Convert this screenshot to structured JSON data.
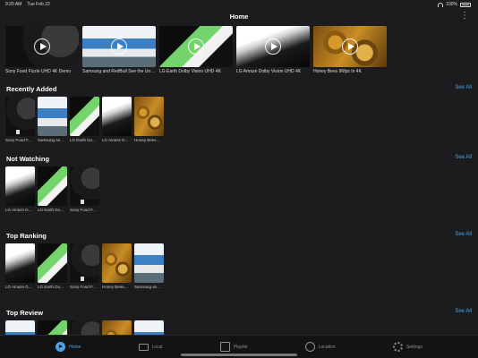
{
  "status": {
    "time": "9:20 AM",
    "date": "Tue Feb 22",
    "battery": "100%"
  },
  "header": {
    "title": "Home",
    "more": "⋮"
  },
  "featured": [
    {
      "label": "Sony Food Fizzle UHD 4K Demo",
      "thumb": "sony"
    },
    {
      "label": "Samsung and RedBull See the Unexpected",
      "thumb": "samsung"
    },
    {
      "label": "LG Earth Dolby Vision UHD 4K",
      "thumb": "lgearth"
    },
    {
      "label": "LG Amaze Dolby Vision UHD 4K",
      "thumb": "lgamaze"
    },
    {
      "label": "Honey Bees 96fps In 4K",
      "thumb": "bees"
    }
  ],
  "sections": [
    {
      "title": "Recently Added",
      "see_all": "See All",
      "items": [
        {
          "label": "Sony Food F...",
          "thumb": "sony",
          "doc": true
        },
        {
          "label": "Samsung an...",
          "thumb": "samsung",
          "doc": false
        },
        {
          "label": "LG Earth Do...",
          "thumb": "lgearth",
          "doc": false
        },
        {
          "label": "LG Amaze D...",
          "thumb": "lgamaze",
          "doc": false
        },
        {
          "label": "Honey Bees...",
          "thumb": "bees",
          "doc": false
        }
      ]
    },
    {
      "title": "Not Watching",
      "see_all": "See All",
      "items": [
        {
          "label": "LG Amaze D...",
          "thumb": "lgamaze",
          "doc": false
        },
        {
          "label": "LG Earth Do...",
          "thumb": "lgearth",
          "doc": false
        },
        {
          "label": "Sony Food F...",
          "thumb": "sony",
          "doc": true
        }
      ]
    },
    {
      "title": "Top Ranking",
      "see_all": "See All",
      "items": [
        {
          "label": "LG Amaze D...",
          "thumb": "lgamaze",
          "doc": false
        },
        {
          "label": "LG Earth Do...",
          "thumb": "lgearth",
          "doc": false
        },
        {
          "label": "Sony Food F...",
          "thumb": "sony",
          "doc": true
        },
        {
          "label": "Honey Bees...",
          "thumb": "bees",
          "doc": false
        },
        {
          "label": "Samsung an...",
          "thumb": "samsung",
          "doc": false
        }
      ]
    },
    {
      "title": "Top Review",
      "see_all": "See All",
      "items": [
        {
          "label": "",
          "thumb": "samsung",
          "doc": false
        },
        {
          "label": "",
          "thumb": "lgearth",
          "doc": false
        },
        {
          "label": "",
          "thumb": "sony",
          "doc": false
        },
        {
          "label": "",
          "thumb": "bees",
          "doc": false
        },
        {
          "label": "",
          "thumb": "samsung",
          "doc": false
        }
      ]
    }
  ],
  "tabs": [
    {
      "label": "Home",
      "icon": "play-circle-icon",
      "active": true
    },
    {
      "label": "Local",
      "icon": "monitor-icon",
      "active": false
    },
    {
      "label": "Playlist",
      "icon": "playlist-icon",
      "active": false
    },
    {
      "label": "Location",
      "icon": "globe-icon",
      "active": false
    },
    {
      "label": "Settings",
      "icon": "gear-icon",
      "active": false
    }
  ],
  "colors": {
    "accent": "#4aa3e8",
    "background": "#1c1c1e",
    "tabbar": "#131313"
  }
}
